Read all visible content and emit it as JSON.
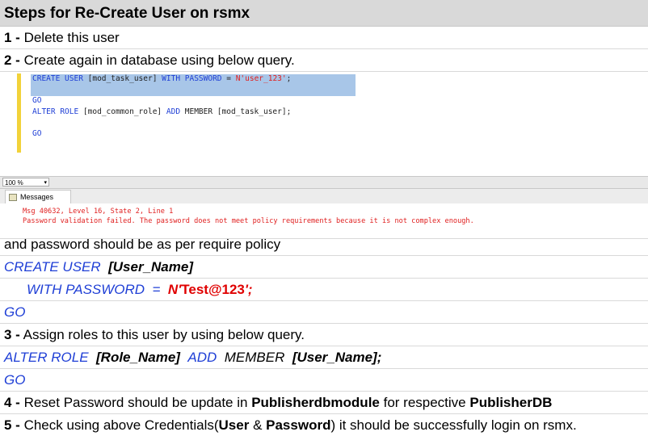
{
  "title": "Steps for Re-Create User on rsmx",
  "steps": {
    "s1": {
      "num": "1 -",
      "text": " Delete this user"
    },
    "s2": {
      "num": "2 -",
      "text": " Create again in database using below query."
    },
    "s3": {
      "num": "3 -",
      "text": " Assign roles to this user by using below query."
    },
    "s4": {
      "num": "4 -",
      "t1": " Reset Password should be update in ",
      "b1": "Publisherdbmodule",
      "t2": " for respective ",
      "b2": "PublisherDB"
    },
    "s5": {
      "num": "5 -",
      "t1": " Check using above Credentials(",
      "b1": "User",
      "t2": " & ",
      "b2": "Password",
      "t3": ") it should be successfully login on rsmx."
    }
  },
  "screenshot": {
    "line1": {
      "kw1": "CREATE USER",
      "ident": " [mod_task_user] ",
      "kw2": "WITH PASSWORD",
      "eq": " = ",
      "str": "N'user_123'",
      "semi": ";"
    },
    "line2": "GO",
    "line3": {
      "kw1": "ALTER ROLE",
      "ident1": " [mod_common_role] ",
      "kw2": "ADD",
      "ident2": " MEMBER [mod_task_user];"
    },
    "line4": "GO",
    "zoom": "100 %",
    "messages_tab": "Messages",
    "error_line1": "Msg 40632, Level 16, State 2, Line 1",
    "error_line2": "Password validation failed. The password does not meet policy requirements because it is not complex enough."
  },
  "policy_note": "and password should be as per require policy",
  "query1": {
    "create_kw": "CREATE USER",
    "user_name": "[User_Name]",
    "with_kw": "WITH PASSWORD",
    "eq": "=",
    "n": "N'",
    "pwd": "Test@123",
    "end": "';",
    "go": "GO"
  },
  "query2": {
    "alter_kw": "ALTER ROLE",
    "role_name": "[Role_Name]",
    "add_kw": "ADD",
    "member_kw": "MEMBER",
    "user_name": "[User_Name];",
    "go": "GO"
  }
}
